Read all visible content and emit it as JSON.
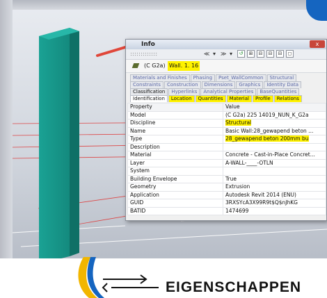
{
  "panel": {
    "title": "Info",
    "close_glyph": "x",
    "toolbar": [
      "≪",
      "▾",
      "≫",
      "▾",
      "↺",
      "⊞",
      "⊟",
      "⊟",
      "⊟",
      "◻"
    ],
    "element_ref": "(C G2a)",
    "element_name": "Wall. 1. 16",
    "tab_rows": [
      [
        {
          "label": "Materials and Finishes",
          "style": ""
        },
        {
          "label": "Phasing",
          "style": ""
        },
        {
          "label": "Pset_WallCommon",
          "style": ""
        },
        {
          "label": "Structural",
          "style": ""
        }
      ],
      [
        {
          "label": "Constraints",
          "style": ""
        },
        {
          "label": "Construction",
          "style": ""
        },
        {
          "label": "Dimensions",
          "style": ""
        },
        {
          "label": "Graphics",
          "style": ""
        },
        {
          "label": "Identity Data",
          "style": ""
        }
      ],
      [
        {
          "label": "Classification",
          "style": "dark"
        },
        {
          "label": "Hyperlinks",
          "style": ""
        },
        {
          "label": "Analytical Properties",
          "style": ""
        },
        {
          "label": "BaseQuantities",
          "style": ""
        }
      ],
      [
        {
          "label": "Identification",
          "style": "active"
        },
        {
          "label": "Location",
          "style": "hl"
        },
        {
          "label": "Quantities",
          "style": "hl"
        },
        {
          "label": "Material",
          "style": "hl"
        },
        {
          "label": "Profile",
          "style": "hl"
        },
        {
          "label": "Relations",
          "style": "hl"
        }
      ]
    ],
    "columns": [
      "Property",
      "Value"
    ],
    "rows": [
      {
        "p": "Model",
        "v": "(C G2a) 225 14019_NUN_K_G2a",
        "hl": false
      },
      {
        "p": "Discipline",
        "v": "Structural",
        "hl": true
      },
      {
        "p": "Name",
        "v": "Basic Wall:28_gewapend beton ...",
        "hl": false
      },
      {
        "p": "Type",
        "v": "28_gewapend beton 200mm bu",
        "hl": true
      },
      {
        "p": "Description",
        "v": "",
        "hl": false
      },
      {
        "p": "Material",
        "v": "Concrete - Cast-in-Place Concret...",
        "hl": false
      },
      {
        "p": "Layer",
        "v": "A-WALL-____-OTLN",
        "hl": false
      },
      {
        "p": "System",
        "v": "",
        "hl": false
      },
      {
        "p": "Building Envelope",
        "v": "True",
        "hl": false
      },
      {
        "p": "Geometry",
        "v": "Extrusion",
        "hl": false
      },
      {
        "p": "Application",
        "v": "Autodesk Revit 2014 (ENU)",
        "hl": false
      },
      {
        "p": "GUID",
        "v": "3RXSYcA3X99R9t$Q$nJhKG",
        "hl": false
      },
      {
        "p": "BATID",
        "v": "1474699",
        "hl": false
      }
    ]
  },
  "footer": {
    "heading": "EIGENSCHAPPEN"
  },
  "colors": {
    "wall": "#1b9e92",
    "highlight": "#fff200",
    "arrow": "#e0473a",
    "accent": "#1565c0"
  }
}
